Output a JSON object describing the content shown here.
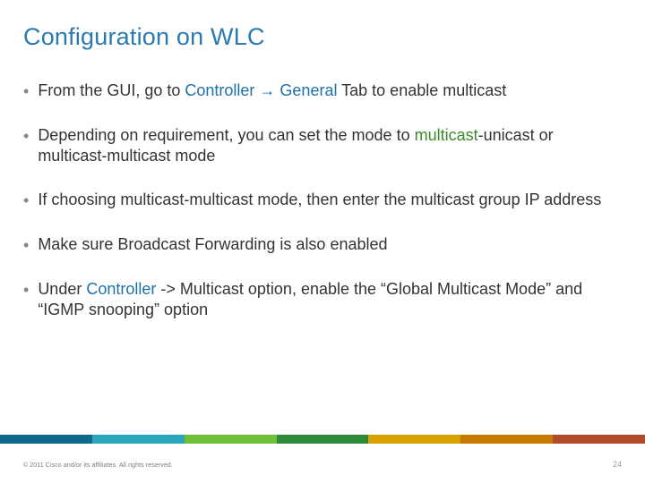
{
  "title": "Configuration on WLC",
  "bullets": {
    "b1": {
      "pre": "From the GUI, go to ",
      "controller": "Controller",
      "arrow": " → ",
      "general": "General",
      "post": " Tab to enable multicast"
    },
    "b2": {
      "pre": "Depending on requirement, you can set the mode to ",
      "m1": "multicast",
      "dash": "-",
      "u1": "unicast",
      "mid": " or ",
      "m2": "multicast-multicast",
      "post": " mode"
    },
    "b3": {
      "pre": "If choosing ",
      "mm": "multicast-multicast",
      "post": " mode, then enter the multicast group IP address"
    },
    "b4": {
      "text": "Make sure Broadcast Forwarding is also enabled"
    },
    "b5": {
      "pre": "Under ",
      "controller": "Controller",
      "post": " -> Multicast option, enable the “Global Multicast Mode”  and “IGMP snooping” option"
    }
  },
  "footer": {
    "copyright": "© 2011  Cisco and/or its affiliates. All rights reserved.",
    "page": "24"
  }
}
